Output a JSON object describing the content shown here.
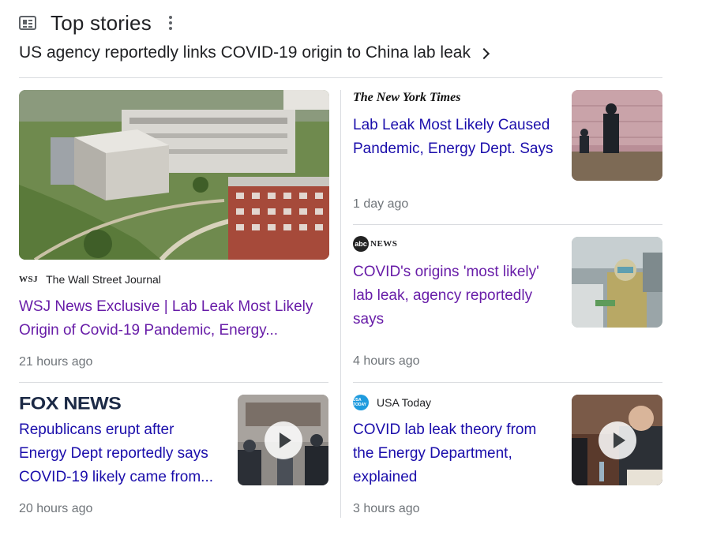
{
  "header": {
    "title": "Top stories",
    "subtitle": "US agency reportedly links COVID-19 origin to China lab leak"
  },
  "stories": [
    {
      "publisher": "The Wall Street Journal",
      "logo_text": "WSJ",
      "headline_line1": "WSJ News Exclusive | Lab Leak Most Likely",
      "headline_line2": "Origin of Covid-19 Pandemic, Energy...",
      "time": "21 hours ago",
      "thumbnail": "wuhan-lab-aerial-photo"
    },
    {
      "publisher": "The New York Times",
      "logo_text": "The New York Times",
      "headline_line1": "Lab Leak Most Likely Caused",
      "headline_line2": "Pandemic, Energy Dept. Says",
      "time": "1 day ago",
      "thumbnail": "guards-on-rooftop-photo"
    },
    {
      "publisher": "ABC News",
      "logo_text": "abc",
      "logo_text2": "NEWS",
      "headline_line1": "COVID's origins 'most likely'",
      "headline_line2": "lab leak, agency reportedly",
      "headline_line3": "says",
      "time": "4 hours ago",
      "thumbnail": "hospital-worker-photo"
    },
    {
      "publisher": "Fox News",
      "logo_text": "FOX NEWS",
      "headline_line1": "Republicans erupt after",
      "headline_line2": "Energy Dept reportedly says",
      "headline_line3": "COVID-19 likely came from...",
      "time": "20 hours ago",
      "thumbnail": "lab-entrance-video"
    },
    {
      "publisher": "USA Today",
      "logo_text": "USA TODAY",
      "headline_line1": "COVID lab leak theory from",
      "headline_line2": "the Energy Department,",
      "headline_line3": "explained",
      "time": "3 hours ago",
      "thumbnail": "fauci-hearing-video"
    }
  ],
  "colors": {
    "link": "#1a0dab",
    "visited": "#681da8",
    "meta": "#70757a",
    "divider": "#dadce0"
  }
}
